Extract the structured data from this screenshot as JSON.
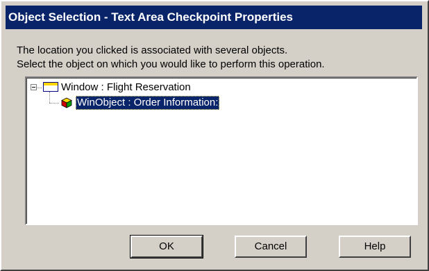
{
  "dialog": {
    "title": "Object Selection - Text Area Checkpoint Properties",
    "message_line1": "The location you clicked is associated with several objects.",
    "message_line2": "Select the object on which you would like to perform this operation."
  },
  "tree": {
    "root": {
      "label": "Window : Flight Reservation",
      "icon": "window-icon",
      "expanded": true
    },
    "child": {
      "label": "WinObject : Order Information:",
      "icon": "cube-icon",
      "selected": true
    }
  },
  "buttons": {
    "ok": "OK",
    "cancel": "Cancel",
    "help": "Help"
  },
  "colors": {
    "titlebar": "#0a246a",
    "selection": "#0a246a",
    "dialog_bg": "#d4d0c8"
  }
}
